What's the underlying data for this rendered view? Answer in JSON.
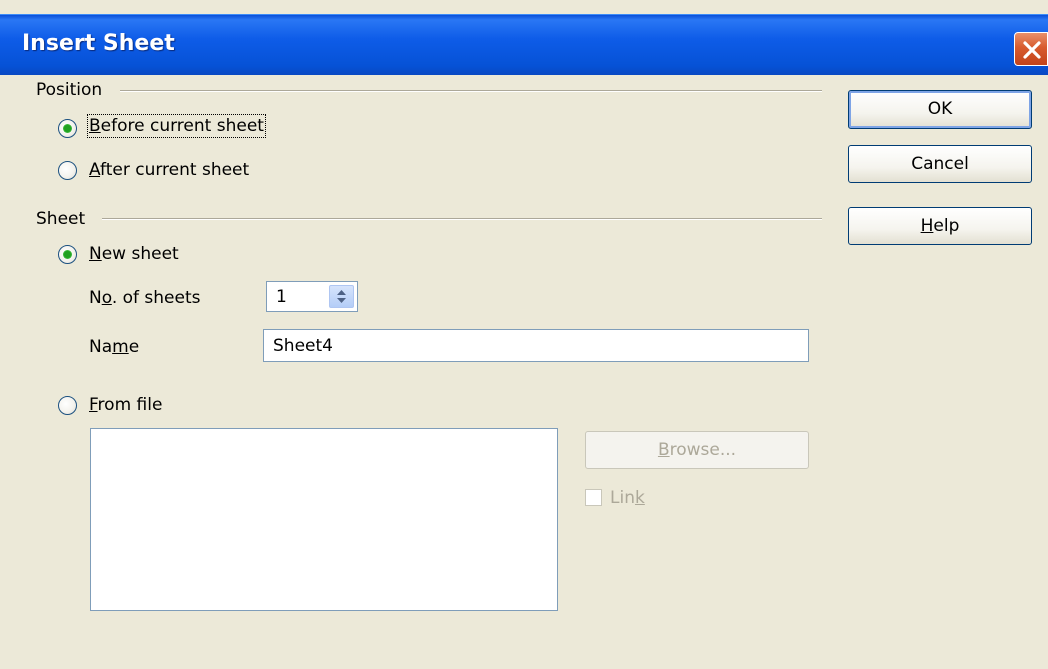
{
  "window": {
    "title": "Insert Sheet"
  },
  "position_group": {
    "label": "Position",
    "before": {
      "label": "Before current sheet",
      "checked": true
    },
    "after": {
      "label": "After current sheet",
      "checked": false
    }
  },
  "sheet_group": {
    "label": "Sheet",
    "new_sheet": {
      "label": "New sheet",
      "checked": true
    },
    "num_sheets": {
      "label": "No. of sheets",
      "value": "1"
    },
    "name": {
      "label": "Name",
      "value": "Sheet4"
    },
    "from_file": {
      "label": "From file",
      "checked": false
    },
    "browse_label": "Browse...",
    "link": {
      "label": "Link",
      "checked": false
    }
  },
  "buttons": {
    "ok": "OK",
    "cancel": "Cancel",
    "help": "Help"
  },
  "colors": {
    "titlebar": "#0A59E0",
    "dialog_bg": "#ECE9D8",
    "radio_dot": "#21A121",
    "close_button": "#D85B2E"
  },
  "icons": {
    "close": "close-icon",
    "spin": "spin-arrows-icon"
  }
}
